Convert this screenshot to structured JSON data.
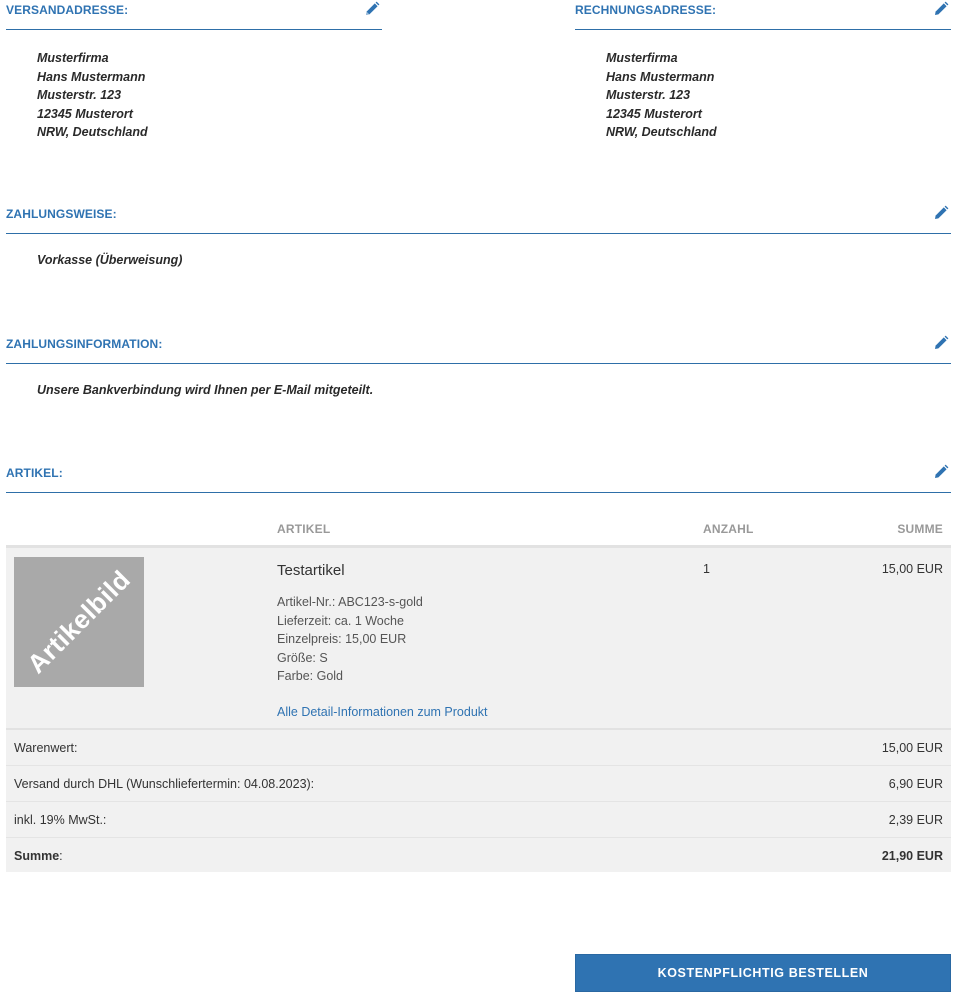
{
  "shipping": {
    "title": "VERSANDADRESSE:",
    "lines": [
      "Musterfirma",
      "Hans Mustermann",
      "Musterstr. 123",
      "12345 Musterort",
      "NRW, Deutschland"
    ]
  },
  "billing": {
    "title": "RECHNUNGSADRESSE:",
    "lines": [
      "Musterfirma",
      "Hans Mustermann",
      "Musterstr. 123",
      "12345 Musterort",
      "NRW, Deutschland"
    ]
  },
  "payment": {
    "title": "ZAHLUNGSWEISE:",
    "method": "Vorkasse (Überweisung)"
  },
  "payment_info": {
    "title": "ZAHLUNGSINFORMATION:",
    "text": "Unsere Bankverbindung wird Ihnen per E-Mail mitgeteilt."
  },
  "articles": {
    "title": "ARTIKEL:",
    "columns": {
      "article": "ARTIKEL",
      "quantity": "ANZAHL",
      "sum": "SUMME"
    },
    "items": [
      {
        "image_text": "Artikelbild",
        "name": "Testartikel",
        "details": [
          "Artikel-Nr.: ABC123-s-gold",
          "Lieferzeit: ca. 1 Woche",
          "Einzelpreis: 15,00 EUR",
          "Größe: S",
          "Farbe: Gold"
        ],
        "link": "Alle Detail-Informationen zum Produkt",
        "quantity": "1",
        "sum": "15,00 EUR"
      }
    ]
  },
  "totals": [
    {
      "label": "Warenwert:",
      "value": "15,00 EUR"
    },
    {
      "label": "Versand durch DHL (Wunschliefertermin: 04.08.2023):",
      "value": "6,90 EUR"
    },
    {
      "label": "inkl. 19% MwSt.:",
      "value": "2,39 EUR"
    }
  ],
  "grand_total": {
    "label": "Summe",
    "suffix": ":",
    "value": "21,90 EUR"
  },
  "order_button": "KOSTENPFLICHTIG BESTELLEN",
  "colors": {
    "accent": "#2f73b2",
    "row_bg": "#f1f1f1",
    "placeholder": "#a9a9a9"
  },
  "icons": {
    "edit": "pencil-icon"
  }
}
